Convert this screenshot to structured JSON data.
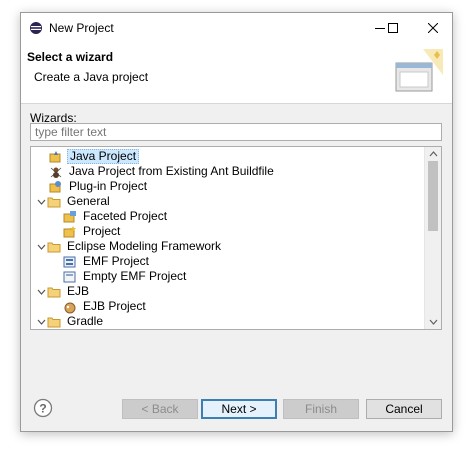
{
  "window": {
    "title": "New Project"
  },
  "header": {
    "title": "Select a wizard",
    "subtitle": "Create a Java project"
  },
  "wizards": {
    "label": "Wizards:",
    "filter_placeholder": "type filter text",
    "items": [
      {
        "label": "Java Project",
        "level": 0,
        "icon": "java-project-icon",
        "selected": true
      },
      {
        "label": "Java Project from Existing Ant Buildfile",
        "level": 0,
        "icon": "ant-icon"
      },
      {
        "label": "Plug-in Project",
        "level": 0,
        "icon": "plugin-project-icon"
      },
      {
        "label": "General",
        "level": 0,
        "icon": "folder-icon",
        "expanded": true
      },
      {
        "label": "Faceted Project",
        "level": 1,
        "icon": "faceted-project-icon"
      },
      {
        "label": "Project",
        "level": 1,
        "icon": "project-icon"
      },
      {
        "label": "Eclipse Modeling Framework",
        "level": 0,
        "icon": "folder-icon",
        "expanded": true
      },
      {
        "label": "EMF Project",
        "level": 1,
        "icon": "emf-project-icon"
      },
      {
        "label": "Empty EMF Project",
        "level": 1,
        "icon": "empty-emf-project-icon"
      },
      {
        "label": "EJB",
        "level": 0,
        "icon": "folder-icon",
        "expanded": true
      },
      {
        "label": "EJB Project",
        "level": 1,
        "icon": "ejb-project-icon"
      },
      {
        "label": "Gradle",
        "level": 0,
        "icon": "folder-icon",
        "expanded": true
      }
    ]
  },
  "buttons": {
    "back": "< Back",
    "next": "Next >",
    "finish": "Finish",
    "cancel": "Cancel"
  },
  "colors": {
    "selection": "#cce8ff",
    "default_button_border": "#3c7fb1",
    "folder": "#e8b84a"
  }
}
